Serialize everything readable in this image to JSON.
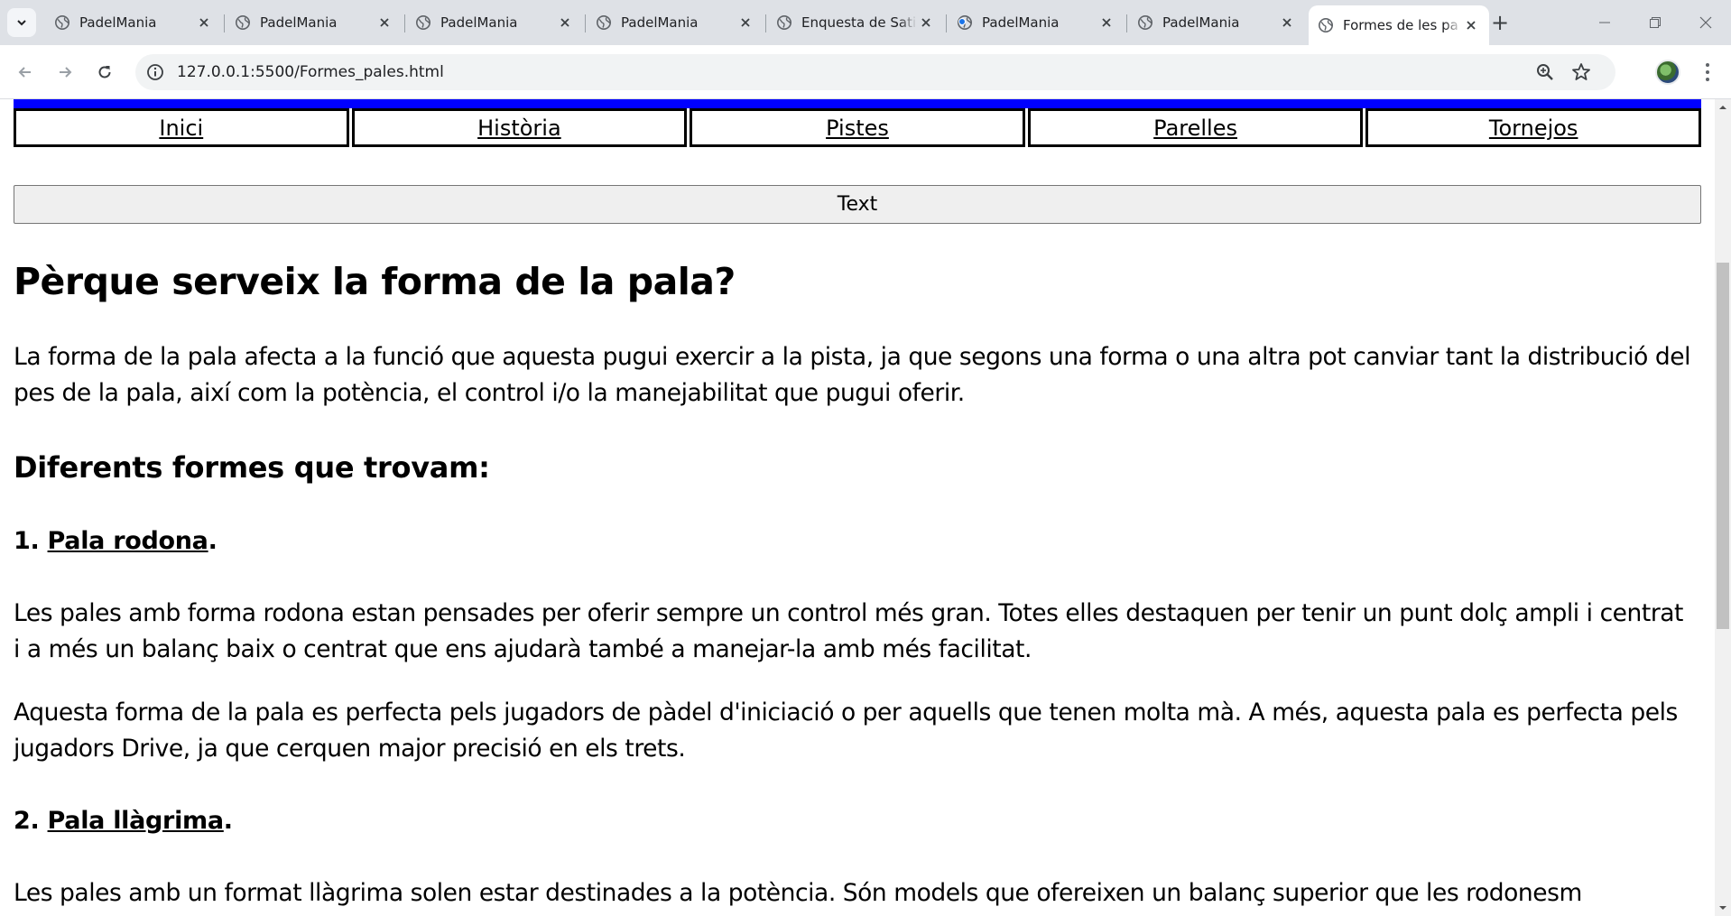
{
  "browser": {
    "tabs": [
      {
        "title": "PadelMania",
        "loading": false
      },
      {
        "title": "PadelMania",
        "loading": false
      },
      {
        "title": "PadelMania",
        "loading": false
      },
      {
        "title": "PadelMania",
        "loading": false
      },
      {
        "title": "Enquesta de Sati",
        "loading": false
      },
      {
        "title": "PadelMania",
        "loading": true
      },
      {
        "title": "PadelMania",
        "loading": false
      },
      {
        "title": "Formes de les pa",
        "loading": false,
        "active": true
      }
    ],
    "url": "127.0.0.1:5500/Formes_pales.html",
    "new_tab_label": "+",
    "accent_color": "#1a73e8"
  },
  "page": {
    "nav": [
      "Inici",
      "Història",
      "Pistes",
      "Parelles",
      "Tornejos"
    ],
    "text_button": "Text",
    "heading": "Pèrque serveix la forma de la pala?",
    "intro": "La forma de la pala afecta a la funció que aquesta pugui exercir a la pista, ja que segons una forma o una altra pot canviar tant la distribució del pes de la pala, així com la potència, el control i/o la manejabilitat que pugui oferir.",
    "subheading": "Diferents formes que trovam:",
    "section1": {
      "number": "1. ",
      "name": "Pala rodona",
      "suffix": ".",
      "p1": "Les pales amb forma rodona estan pensades per oferir sempre un control més gran. Totes elles destaquen per tenir un punt dolç ampli i centrat i a més un balanç baix o centrat que ens ajudarà també a manejar-la amb més facilitat.",
      "p2": "Aquesta forma de la pala es perfecta pels jugadors de pàdel d'iniciació o per aquells que tenen molta mà. A més, aquesta pala es perfecta pels jugadors Drive, ja que cerquen major precisió en els trets."
    },
    "section2": {
      "number": "2. ",
      "name": "Pala llàgrima",
      "suffix": ".",
      "p1": "Les pales amb un format llàgrima solen estar destinades a la potència. Són models que ofereixen un balanç superior que les rodonesm"
    },
    "bar_color": "#0000ff"
  }
}
